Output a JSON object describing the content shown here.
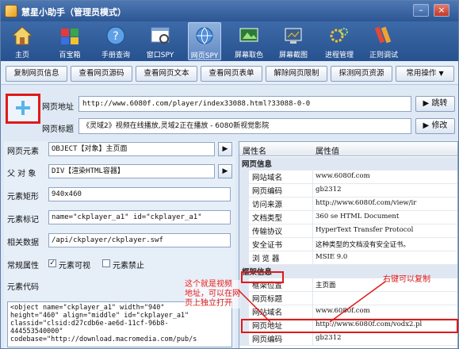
{
  "window": {
    "title": "慧星小助手（管理员模式）"
  },
  "toolbar": [
    {
      "label": "主页",
      "icon": "home-icon"
    },
    {
      "label": "百宝箱",
      "icon": "toolbox-icon"
    },
    {
      "label": "手册查询",
      "icon": "help-icon"
    },
    {
      "label": "窗口SPY",
      "icon": "window-spy-icon"
    },
    {
      "label": "网页SPY",
      "icon": "web-spy-icon"
    },
    {
      "label": "屏幕取色",
      "icon": "color-picker-icon"
    },
    {
      "label": "屏幕截图",
      "icon": "screenshot-icon"
    },
    {
      "label": "进程管理",
      "icon": "process-icon"
    },
    {
      "label": "正则调试",
      "icon": "regex-icon"
    }
  ],
  "buttons": [
    "复制网页信息",
    "查看网页源码",
    "查看网页文本",
    "查看网页表单",
    "解除网页限制",
    "探测网页资源",
    "常用操作"
  ],
  "address": {
    "url_label": "网页地址",
    "url_value": "http://www.6080f.com/player/index33088.html?33088-0-0",
    "jump_label": "跳转",
    "title_label": "网页标题",
    "title_value": "《灵域2》视频在线播放,灵域2正在播放 - 6080新视觉影院",
    "modify_label": "修改"
  },
  "element": {
    "fields": [
      {
        "label": "网页元素",
        "value": "OBJECT【对象】主页面"
      },
      {
        "label": "父 对 象",
        "value": "DIV【渲染HTML容器】"
      },
      {
        "label": "元素矩形",
        "value": "940x460"
      },
      {
        "label": "元素标记",
        "value": "name=\"ckplayer_a1\" id=\"ckplayer_a1\""
      },
      {
        "label": "相关数据",
        "value": "/api/ckplayer/ckplayer.swf"
      }
    ],
    "attr_label": "常规属性",
    "visible_label": "元素可视",
    "disabled_label": "元素禁止",
    "code_label": "元素代码",
    "code": "<object name=\"ckplayer_a1\" width=\"940\"\nheight=\"460\" align=\"middle\" id=\"ckplayer_a1\"\nclassid=\"clsid:d27cdb6e-ae6d-11cf-96b8-\n444553540000\"\ncodebase=\"http://download.macromedia.com/pub/s"
  },
  "grid": {
    "col_name": "属性名",
    "col_value": "属性值",
    "rows": [
      {
        "type": "cat",
        "k": "网页信息",
        "v": ""
      },
      {
        "type": "item",
        "k": "网站域名",
        "v": "www.6080f.com"
      },
      {
        "type": "item",
        "k": "网页编码",
        "v": "gb2312"
      },
      {
        "type": "item",
        "k": "访问来源",
        "v": "http://www.6080f.com/view/ir"
      },
      {
        "type": "item",
        "k": "文档类型",
        "v": "360 se HTML Document"
      },
      {
        "type": "item",
        "k": "传输协议",
        "v": "HyperText Transfer Protocol"
      },
      {
        "type": "item",
        "k": "安全证书",
        "v": "这种类型的文档没有安全证书。"
      },
      {
        "type": "item",
        "k": "浏 览 器",
        "v": "MSIE 9.0"
      },
      {
        "type": "cat",
        "k": "框架信息",
        "v": ""
      },
      {
        "type": "item",
        "k": "框架位置",
        "v": "主页面"
      },
      {
        "type": "item",
        "k": "网页标题",
        "v": ""
      },
      {
        "type": "item",
        "k": "网站域名",
        "v": "www.6080f.com"
      },
      {
        "type": "item",
        "k": "网页地址",
        "v": "http://www.6080f.com/vodx2.pl"
      },
      {
        "type": "item",
        "k": "网页编码",
        "v": "gb2312"
      }
    ]
  },
  "annotations": {
    "note_left_1": "这个就是视频",
    "note_left_2": "地址，可以在网",
    "note_left_3": "页上独立打开",
    "note_right": "右键可以复制"
  }
}
